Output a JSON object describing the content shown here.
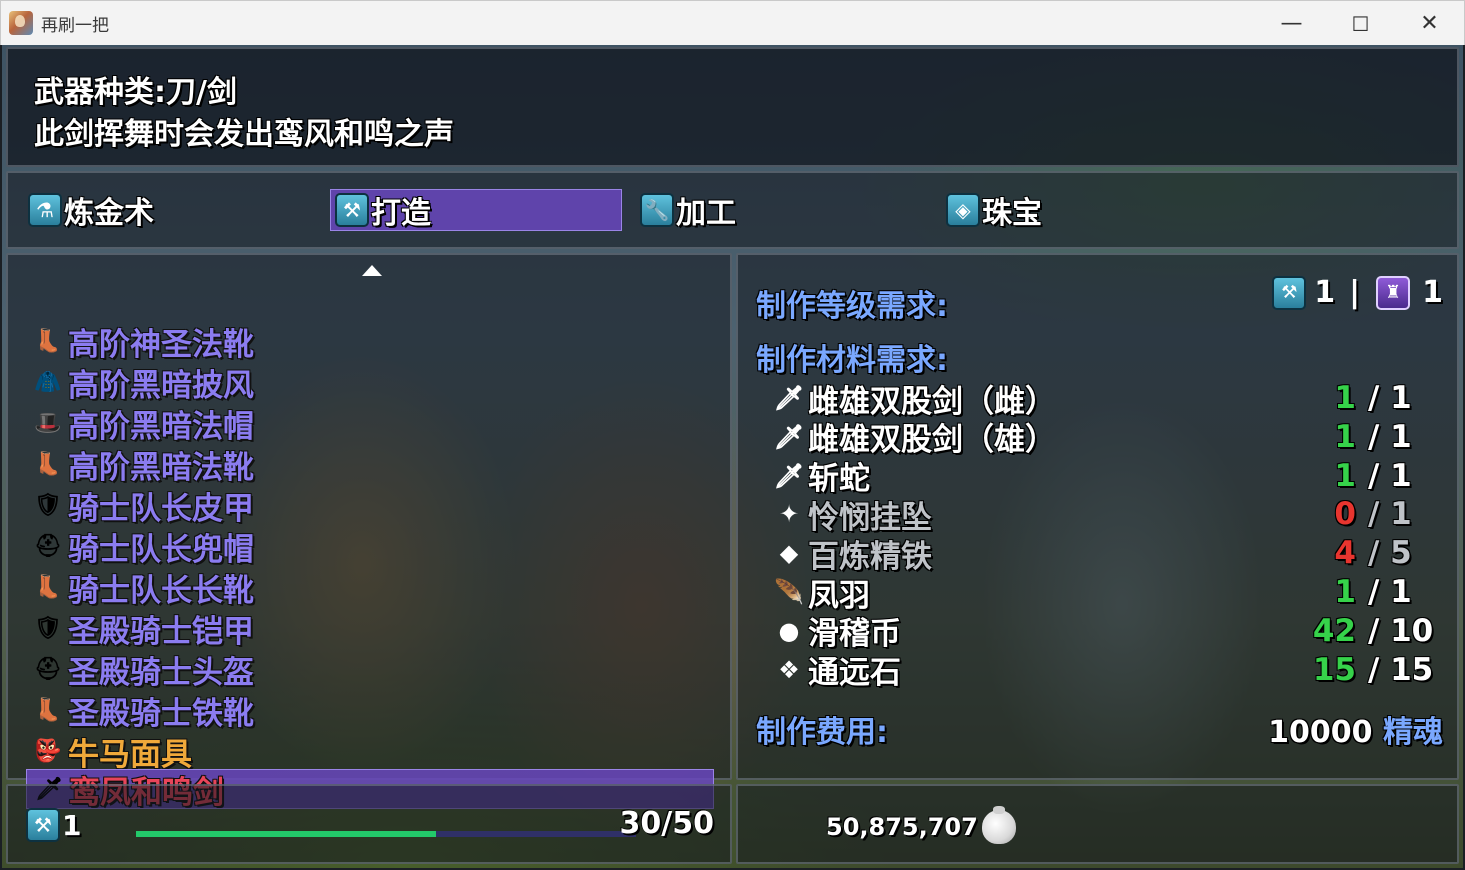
{
  "window": {
    "title": "再刷一把",
    "minimize": "—",
    "maximize": "☐",
    "close": "✕"
  },
  "description": {
    "line1": "武器种类:刀/剑",
    "line2": "此剑挥舞时会发出鸾风和鸣之声"
  },
  "tabs": [
    {
      "label": "炼金术",
      "icon": "cauldron-icon",
      "active": false
    },
    {
      "label": "打造",
      "icon": "anvil-icon",
      "active": true
    },
    {
      "label": "加工",
      "icon": "wrench-icon",
      "active": false
    },
    {
      "label": "珠宝",
      "icon": "gem-icon",
      "active": false
    }
  ],
  "items": [
    {
      "name": "高阶神圣法靴",
      "color": "#8b7cf0",
      "icon": "boots-icon"
    },
    {
      "name": "高阶黑暗披风",
      "color": "#8b7cf0",
      "icon": "cloak-icon"
    },
    {
      "name": "高阶黑暗法帽",
      "color": "#8b7cf0",
      "icon": "hat-icon"
    },
    {
      "name": "高阶黑暗法靴",
      "color": "#8b7cf0",
      "icon": "boots-icon"
    },
    {
      "name": "骑士队长皮甲",
      "color": "#8b7cf0",
      "icon": "armor-icon"
    },
    {
      "name": "骑士队长兜帽",
      "color": "#8b7cf0",
      "icon": "helmet-icon"
    },
    {
      "name": "骑士队长长靴",
      "color": "#8b7cf0",
      "icon": "boots-icon"
    },
    {
      "name": "圣殿骑士铠甲",
      "color": "#8b7cf0",
      "icon": "armor-icon"
    },
    {
      "name": "圣殿骑士头盔",
      "color": "#8b7cf0",
      "icon": "helmet-icon"
    },
    {
      "name": "圣殿骑士铁靴",
      "color": "#8b7cf0",
      "icon": "boots-icon"
    },
    {
      "name": "牛马面具",
      "color": "#f0a93a",
      "icon": "mask-icon"
    },
    {
      "name": "鸾凤和鸣剑",
      "color": "#e8455a",
      "icon": "sword-icon",
      "selected": true
    }
  ],
  "detail": {
    "level_label": "制作等级需求:",
    "req_craft_level": "1",
    "req_sep": "|",
    "req_class_level": "1",
    "materials_label": "制作材料需求:",
    "materials": [
      {
        "name": "雌雄双股剑（雌）",
        "have": "1",
        "need": "/ 1",
        "color": "#36d24a",
        "icon": "sword-icon"
      },
      {
        "name": "雌雄双股剑（雄）",
        "have": "1",
        "need": "/ 1",
        "color": "#36d24a",
        "icon": "sword-icon"
      },
      {
        "name": "斩蛇",
        "have": "1",
        "need": "/ 1",
        "color": "#36d24a",
        "icon": "sword-icon"
      },
      {
        "name": "怜悯挂坠",
        "have": "0",
        "need": "/ 1",
        "color": "#e8352f",
        "icon": "pendant-icon",
        "dim": true
      },
      {
        "name": "百炼精铁",
        "have": "4",
        "need": "/ 5",
        "color": "#e8352f",
        "icon": "ore-icon",
        "dim": true
      },
      {
        "name": "凤羽",
        "have": "1",
        "need": "/ 1",
        "color": "#36d24a",
        "icon": "feather-icon"
      },
      {
        "name": "滑稽币",
        "have": "42",
        "need": "/ 10",
        "color": "#36d24a",
        "icon": "coin-icon"
      },
      {
        "name": "通远石",
        "have": "15",
        "need": "/ 15",
        "color": "#36d24a",
        "icon": "stone-icon"
      }
    ],
    "cost_label": "制作费用:",
    "cost_amount": "10000",
    "cost_unit": "精魂"
  },
  "status": {
    "level": "1",
    "xp_text": "30/50",
    "xp_fraction": 0.6,
    "gold": "50,875,707"
  },
  "colors": {
    "accent_purple": "#6846be",
    "label_blue": "#7aa8ff",
    "ok_green": "#36d24a",
    "lack_red": "#e8352f"
  }
}
